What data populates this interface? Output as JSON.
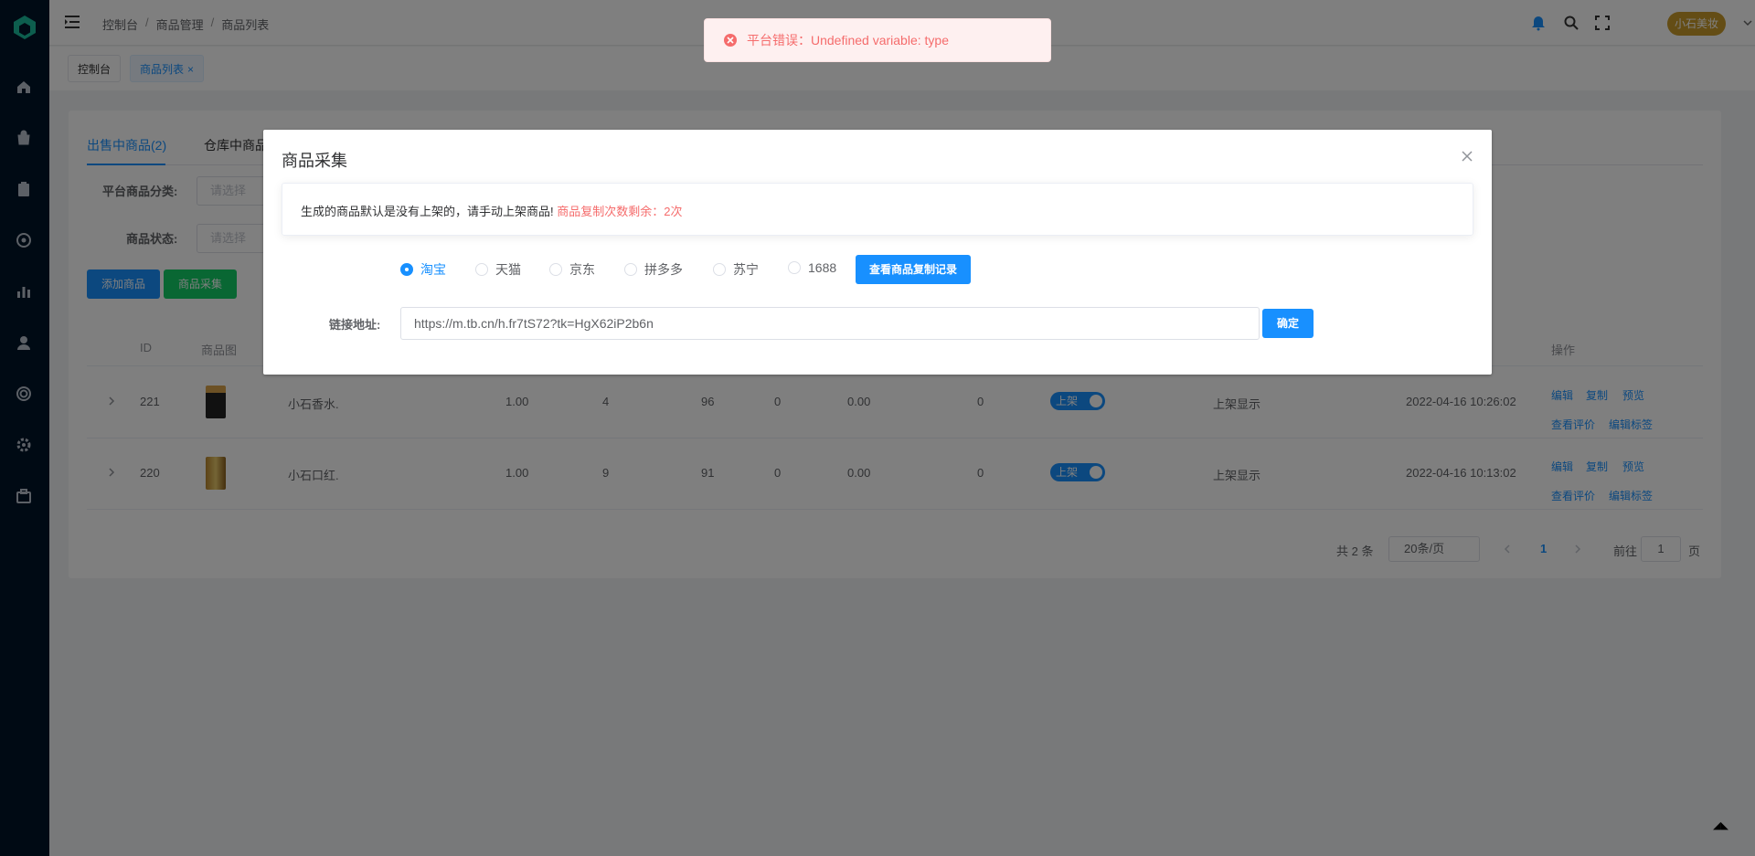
{
  "breadcrumb": [
    "控制台",
    "商品管理",
    "商品列表"
  ],
  "header": {
    "shop_name": "小石美妆"
  },
  "tags": [
    {
      "label": "控制台"
    },
    {
      "label": "商品列表",
      "close": "×"
    }
  ],
  "tabs": [
    {
      "label": "出售中商品(2)"
    },
    {
      "label": "仓库中商品"
    }
  ],
  "filters": {
    "category_label": "平台商品分类:",
    "category_placeholder": "请选择",
    "status_label": "商品状态:",
    "status_placeholder": "请选择"
  },
  "buttons": {
    "add": "添加商品",
    "collect": "商品采集"
  },
  "table": {
    "headers": {
      "id": "ID",
      "image": "商品图",
      "ops": "操作"
    },
    "rows": [
      {
        "id": "221",
        "name": "小石香水.",
        "price": "1.00",
        "sales": "4",
        "stock": "96",
        "c1": "0",
        "c2": "0.00",
        "c3": "0",
        "switch": "上架",
        "status": "上架显示",
        "time": "2022-04-16 10:26:02",
        "ops": [
          "编辑",
          "复制",
          "预览",
          "查看评价",
          "编辑标签"
        ]
      },
      {
        "id": "220",
        "name": "小石口红.",
        "price": "1.00",
        "sales": "9",
        "stock": "91",
        "c1": "0",
        "c2": "0.00",
        "c3": "0",
        "switch": "上架",
        "status": "上架显示",
        "time": "2022-04-16 10:13:02",
        "ops": [
          "编辑",
          "复制",
          "预览",
          "查看评价",
          "编辑标签"
        ]
      }
    ]
  },
  "pagination": {
    "total": "共 2 条",
    "page_size": "20条/页",
    "current": "1",
    "goto_prefix": "前往",
    "goto_value": "1",
    "goto_suffix": "页"
  },
  "dialog": {
    "title": "商品采集",
    "notice": "生成的商品默认是没有上架的，请手动上架商品!",
    "notice_warn": "商品复制次数剩余：2次",
    "platforms": [
      {
        "label": "淘宝",
        "checked": true
      },
      {
        "label": "天猫"
      },
      {
        "label": "京东"
      },
      {
        "label": "拼多多"
      },
      {
        "label": "苏宁"
      },
      {
        "label": "1688"
      }
    ],
    "record_button": "查看商品复制记录",
    "url_label": "链接地址:",
    "url_value": "https://m.tb.cn/h.fr7tS72?tk=HgX62iP2b6n",
    "confirm_button": "确定"
  },
  "toast": {
    "message": "平台错误：Undefined variable: type"
  },
  "colors": {
    "primary": "#1890ff",
    "sidebar": "#001529",
    "error": "#f56c6c",
    "success": "#13ce66"
  }
}
